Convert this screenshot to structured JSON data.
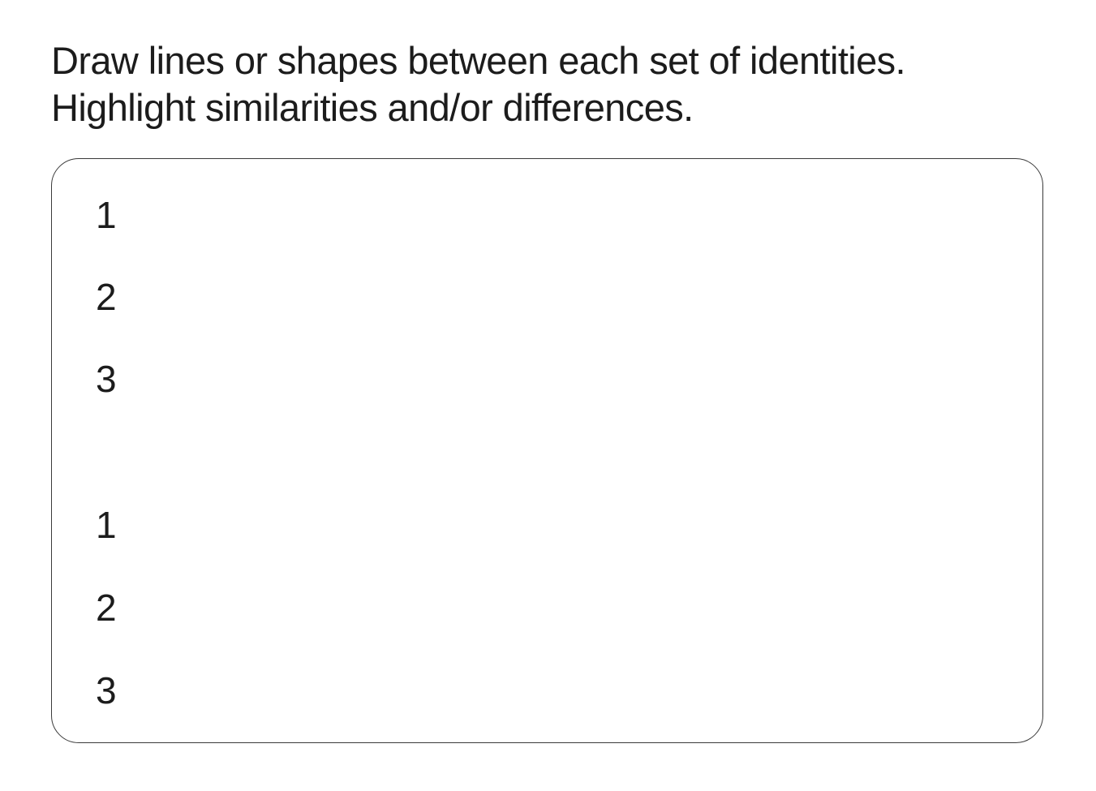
{
  "instructions": {
    "line1": "Draw lines or shapes between each set of identities.",
    "line2": "Highlight similarities and/or differences."
  },
  "panel": {
    "set_a": [
      "1",
      "2",
      "3"
    ],
    "set_b": [
      "1",
      "2",
      "3"
    ]
  }
}
